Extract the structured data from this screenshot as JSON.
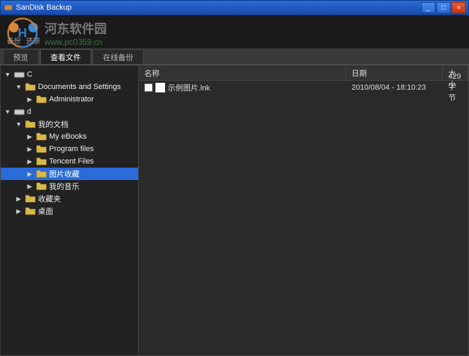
{
  "window": {
    "title": "SanDisk Backup"
  },
  "watermark": {
    "title": "河东软件园",
    "url": "www.pc0359.cn"
  },
  "toolbar": {
    "backup": "备份",
    "restore": "还原"
  },
  "tabs": [
    {
      "label": "预览",
      "active": false
    },
    {
      "label": "查看文件",
      "active": true
    },
    {
      "label": "在线备份",
      "active": false
    }
  ],
  "tree": {
    "nodes": [
      {
        "label": "C",
        "type": "drive",
        "depth": 0,
        "expanded": true,
        "selected": false
      },
      {
        "label": "Documents and Settings",
        "type": "folder",
        "depth": 1,
        "expanded": true,
        "selected": false
      },
      {
        "label": "Administrator",
        "type": "folder",
        "depth": 2,
        "expanded": false,
        "selected": false
      },
      {
        "label": "d",
        "type": "drive",
        "depth": 0,
        "expanded": true,
        "selected": false
      },
      {
        "label": "我的文档",
        "type": "folder",
        "depth": 1,
        "expanded": true,
        "selected": false
      },
      {
        "label": "My eBooks",
        "type": "folder",
        "depth": 2,
        "expanded": false,
        "selected": false
      },
      {
        "label": "Program files",
        "type": "folder",
        "depth": 2,
        "expanded": false,
        "selected": false
      },
      {
        "label": "Tencent Files",
        "type": "folder",
        "depth": 2,
        "expanded": false,
        "selected": false
      },
      {
        "label": "图片收藏",
        "type": "folder",
        "depth": 2,
        "expanded": false,
        "selected": true
      },
      {
        "label": "我的音乐",
        "type": "folder",
        "depth": 2,
        "expanded": false,
        "selected": false
      },
      {
        "label": "收藏夹",
        "type": "folder",
        "depth": 1,
        "expanded": false,
        "selected": false
      },
      {
        "label": "桌面",
        "type": "folder",
        "depth": 1,
        "expanded": false,
        "selected": false
      }
    ]
  },
  "list": {
    "headers": {
      "name": "名称",
      "date": "日期",
      "size": "大小"
    },
    "rows": [
      {
        "name": "示例图片.lnk",
        "date": "2010/08/04 - 18:10:23",
        "size": "429 字节"
      }
    ]
  }
}
